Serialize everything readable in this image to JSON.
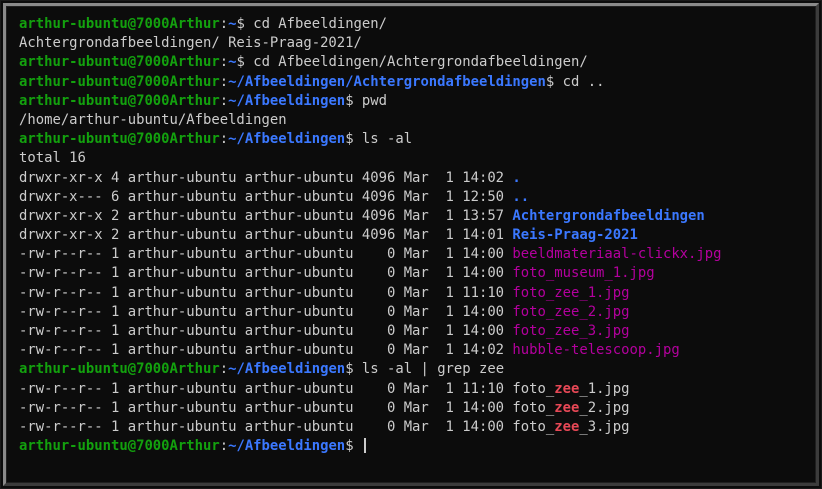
{
  "prompt": {
    "user_host": "arthur-ubuntu@7000Arthur",
    "sep": ":",
    "tilde": "~",
    "dollar": "$ "
  },
  "terminal": {
    "lines": [
      {
        "type": "prompt",
        "path": "~",
        "cmd": "cd Afbeeldingen/"
      },
      {
        "type": "out",
        "text": "Achtergrondafbeeldingen/ Reis-Praag-2021/"
      },
      {
        "type": "prompt",
        "path": "~",
        "cmd": "cd Afbeeldingen/Achtergrondafbeeldingen/"
      },
      {
        "type": "prompt",
        "path": "~/Afbeeldingen/Achtergrondafbeeldingen",
        "cmd": "cd .."
      },
      {
        "type": "prompt",
        "path": "~/Afbeeldingen",
        "cmd": "pwd"
      },
      {
        "type": "out",
        "text": "/home/arthur-ubuntu/Afbeeldingen"
      },
      {
        "type": "prompt",
        "path": "~/Afbeeldingen",
        "cmd": "ls -al"
      },
      {
        "type": "out",
        "text": "total 16"
      },
      {
        "type": "ls",
        "meta": "drwxr-xr-x 4 arthur-ubuntu arthur-ubuntu 4096 Mar  1 14:02 ",
        "name": ".",
        "kind": "dir"
      },
      {
        "type": "ls",
        "meta": "drwxr-x--- 6 arthur-ubuntu arthur-ubuntu 4096 Mar  1 12:50 ",
        "name": "..",
        "kind": "dir"
      },
      {
        "type": "ls",
        "meta": "drwxr-xr-x 2 arthur-ubuntu arthur-ubuntu 4096 Mar  1 13:57 ",
        "name": "Achtergrondafbeeldingen",
        "kind": "dir"
      },
      {
        "type": "ls",
        "meta": "drwxr-xr-x 2 arthur-ubuntu arthur-ubuntu 4096 Mar  1 14:01 ",
        "name": "Reis-Praag-2021",
        "kind": "dir"
      },
      {
        "type": "ls",
        "meta": "-rw-r--r-- 1 arthur-ubuntu arthur-ubuntu    0 Mar  1 14:00 ",
        "name": "beeldmateriaal-clickx.jpg",
        "kind": "img"
      },
      {
        "type": "ls",
        "meta": "-rw-r--r-- 1 arthur-ubuntu arthur-ubuntu    0 Mar  1 14:00 ",
        "name": "foto_museum_1.jpg",
        "kind": "img"
      },
      {
        "type": "ls",
        "meta": "-rw-r--r-- 1 arthur-ubuntu arthur-ubuntu    0 Mar  1 11:10 ",
        "name": "foto_zee_1.jpg",
        "kind": "img"
      },
      {
        "type": "ls",
        "meta": "-rw-r--r-- 1 arthur-ubuntu arthur-ubuntu    0 Mar  1 14:00 ",
        "name": "foto_zee_2.jpg",
        "kind": "img"
      },
      {
        "type": "ls",
        "meta": "-rw-r--r-- 1 arthur-ubuntu arthur-ubuntu    0 Mar  1 14:00 ",
        "name": "foto_zee_3.jpg",
        "kind": "img"
      },
      {
        "type": "ls",
        "meta": "-rw-r--r-- 1 arthur-ubuntu arthur-ubuntu    0 Mar  1 14:02 ",
        "name": "hubble-telescoop.jpg",
        "kind": "img"
      },
      {
        "type": "prompt",
        "path": "~/Afbeeldingen",
        "cmd": "ls -al | grep zee"
      },
      {
        "type": "grep",
        "meta": "-rw-r--r-- 1 arthur-ubuntu arthur-ubuntu    0 Mar  1 11:10 ",
        "pre": "foto_",
        "match": "zee",
        "post": "_1.jpg"
      },
      {
        "type": "grep",
        "meta": "-rw-r--r-- 1 arthur-ubuntu arthur-ubuntu    0 Mar  1 14:00 ",
        "pre": "foto_",
        "match": "zee",
        "post": "_2.jpg"
      },
      {
        "type": "grep",
        "meta": "-rw-r--r-- 1 arthur-ubuntu arthur-ubuntu    0 Mar  1 14:00 ",
        "pre": "foto_",
        "match": "zee",
        "post": "_3.jpg"
      },
      {
        "type": "prompt",
        "path": "~/Afbeeldingen",
        "cmd": "",
        "cursor": true
      }
    ]
  },
  "colors": {
    "background": "#0c0c0c",
    "foreground": "#cccccc",
    "prompt_user": "#13a10e",
    "prompt_path": "#3b78ff",
    "directory": "#3b78ff",
    "image_file": "#b4009e",
    "grep_match": "#e74856"
  }
}
